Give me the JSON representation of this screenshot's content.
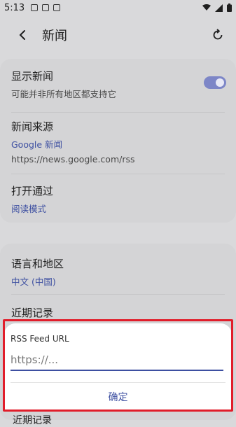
{
  "status_bar": {
    "time": "5:13"
  },
  "header": {
    "title": "新闻"
  },
  "settings": {
    "show_news": {
      "title": "显示新闻",
      "subtitle": "可能并非所有地区都支持它",
      "enabled": true
    },
    "news_source": {
      "title": "新闻来源",
      "provider": "Google 新闻",
      "url": "https://news.google.com/rss"
    },
    "open_via": {
      "title": "打开通过",
      "value": "阅读模式"
    },
    "language_region": {
      "title": "语言和地区",
      "value": "中文 (中国)"
    },
    "recent": {
      "title": "近期记录"
    },
    "bottom_peek": "近期记录"
  },
  "dialog": {
    "label": "RSS Feed URL",
    "placeholder": "https://...",
    "value": "",
    "confirm": "确定"
  },
  "colors": {
    "accent": "#3d4fa1",
    "toggle_on": "#7d86c7",
    "highlight": "#e11d2a"
  }
}
